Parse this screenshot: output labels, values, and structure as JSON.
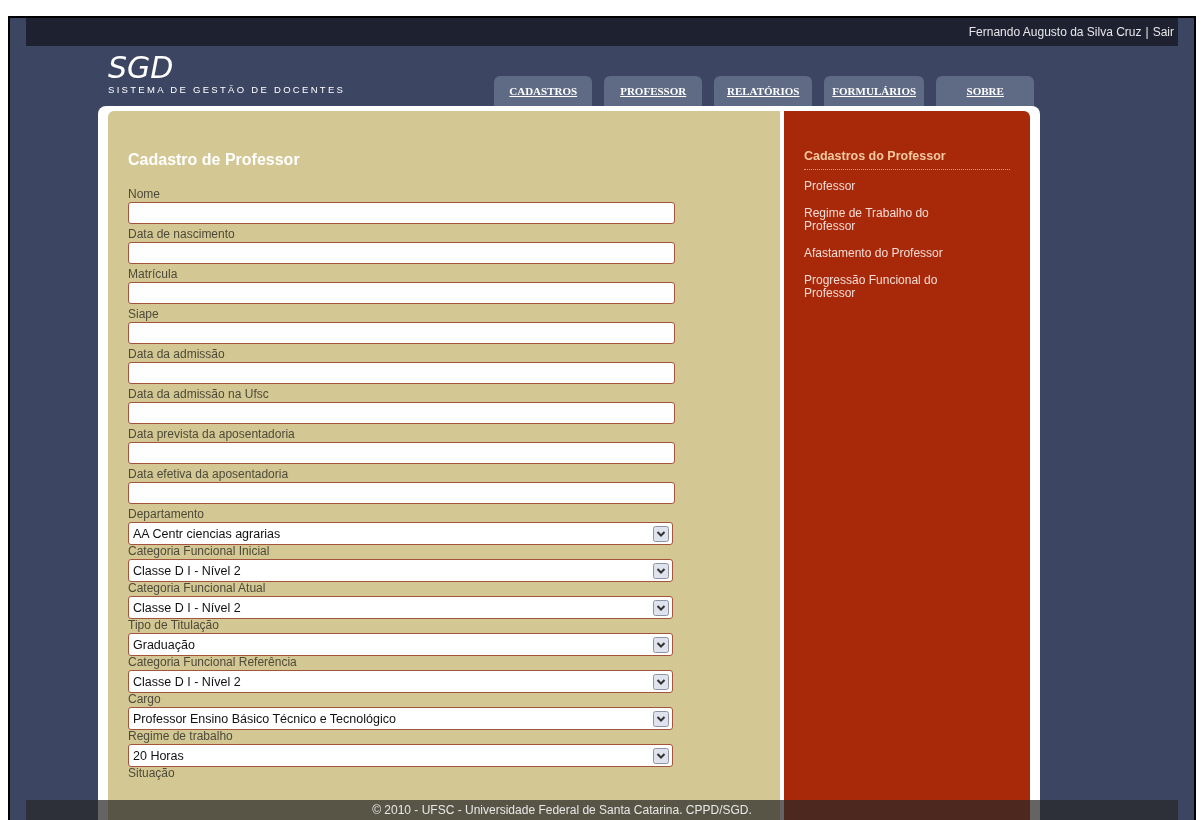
{
  "top_bar": {
    "user": "Fernando Augusto da Silva Cruz",
    "separator": "|",
    "logout": "Sair"
  },
  "logo": {
    "title": "SGD",
    "subtitle": "SISTEMA DE GESTÃO DE DOCENTES"
  },
  "tabs": [
    {
      "label": "CADASTROS"
    },
    {
      "label": "PROFESSOR"
    },
    {
      "label": "RELATÓRIOS"
    },
    {
      "label": "FORMULÁRIOS"
    },
    {
      "label": "SOBRE"
    }
  ],
  "form": {
    "title": "Cadastro de Professor",
    "fields": [
      {
        "kind": "text",
        "label": "Nome"
      },
      {
        "kind": "text",
        "label": "Data de nascimento"
      },
      {
        "kind": "text",
        "label": "Matrícula"
      },
      {
        "kind": "text",
        "label": "Siape"
      },
      {
        "kind": "text",
        "label": "Data da admissão"
      },
      {
        "kind": "text",
        "label": "Data da admissão na Ufsc"
      },
      {
        "kind": "text",
        "label": "Data prevista da aposentadoria"
      },
      {
        "kind": "text",
        "label": "Data efetiva da aposentadoria"
      },
      {
        "kind": "select",
        "label": "Departamento",
        "value": "AA Centr ciencias agrarias"
      },
      {
        "kind": "select",
        "label": "Categoria Funcional Inicial",
        "value": "Classe D I - Nível 2"
      },
      {
        "kind": "select",
        "label": "Categoria Funcional Atual",
        "value": "Classe D I - Nível 2"
      },
      {
        "kind": "select",
        "label": "Tipo de Titulação",
        "value": "Graduação"
      },
      {
        "kind": "select",
        "label": "Categoria Funcional Referência",
        "value": "Classe D I - Nível 2"
      },
      {
        "kind": "select",
        "label": "Cargo",
        "value": "Professor Ensino Básico Técnico e Tecnológico"
      },
      {
        "kind": "select",
        "label": "Regime de trabalho",
        "value": "20 Horas"
      },
      {
        "kind": "label",
        "label": "Situação"
      }
    ]
  },
  "sidebar": {
    "title": "Cadastros do Professor",
    "items": [
      {
        "label": "Professor"
      },
      {
        "label": "Regime de Trabalho do Professor"
      },
      {
        "label": "Afastamento do Professor"
      },
      {
        "label": "Progressão Funcional do Professor"
      }
    ]
  },
  "footer": "© 2010 - UFSC - Universidade Federal de Santa Catarina. CPPD/SGD."
}
